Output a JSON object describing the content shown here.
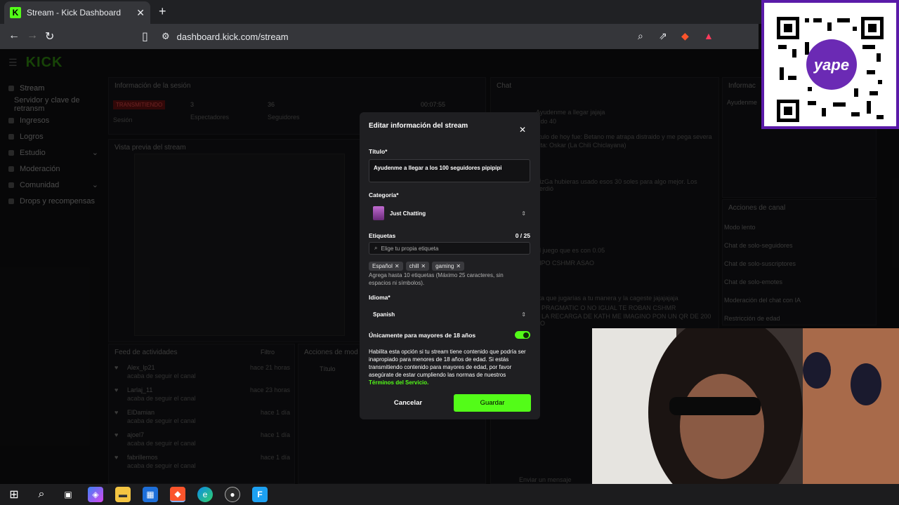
{
  "browser": {
    "tab_title": "Stream - Kick Dashboard",
    "url": "dashboard.kick.com/stream"
  },
  "sidebar": {
    "items": [
      {
        "label": "Stream"
      },
      {
        "label": "Servidor y clave de retransm"
      },
      {
        "label": "Ingresos"
      },
      {
        "label": "Logros"
      },
      {
        "label": "Estudio"
      },
      {
        "label": "Moderación"
      },
      {
        "label": "Comunidad"
      },
      {
        "label": "Drops y recompensas"
      }
    ]
  },
  "session": {
    "header": "Información de la sesión",
    "status": "TRANSMITIENDO",
    "status_sub": "Sesión",
    "viewers": "3",
    "viewers_label": "Espectadores",
    "followers": "36",
    "followers_label": "Seguidores",
    "time": "00:07:55"
  },
  "preview": {
    "header": "Vista previa del stream"
  },
  "feed": {
    "header": "Feed de actividades",
    "filter": "Filtro",
    "items": [
      {
        "name": "Alex_lp21",
        "action": "acaba de seguir el canal",
        "time": "hace 21 horas"
      },
      {
        "name": "Larlaj_11",
        "action": "acaba de seguir el canal",
        "time": "hace 23 horas"
      },
      {
        "name": "ElDamian",
        "action": "acaba de seguir el canal",
        "time": "hace 1 día"
      },
      {
        "name": "ajoel7",
        "action": "acaba de seguir el canal",
        "time": "hace 1 día"
      },
      {
        "name": "fabrillemos",
        "action": "acaba de seguir el canal",
        "time": "hace 1 día"
      }
    ]
  },
  "mod_actions": {
    "header": "Acciones de mod",
    "title_label": "Título"
  },
  "chat": {
    "header": "Chat",
    "input_placeholder": "Enviar un mensaje",
    "lines": [
      "Ayudenme a llegar jajaja",
      "sido 40",
      "titulo de hoy fue: Betano me atrapa distraido y me pega severa",
      "ista: Oskar (La Chili Chiclayana)",
      "trizGa hubieras usado esos 30 soles para algo mejor. Los perdió",
      "al juego que es con 0.05",
      "MPO CSHMR ASAO",
      "sta que jugarías a tu manera y la cageste jajajajaja",
      "A PRAGMATIC O NO IGUAL TE ROBAN CSHMR",
      "A LA RECARGA DE KATH ME IMAGINO PON UN QR DE 200 SO"
    ]
  },
  "channel_actions": {
    "header": "Acciones de canal",
    "items": [
      {
        "label": "Modo lento"
      },
      {
        "label": "Chat de solo-seguidores"
      },
      {
        "label": "Chat de solo-suscriptores"
      },
      {
        "label": "Chat de solo-emotes"
      },
      {
        "label": "Moderación del chat con IA"
      },
      {
        "label": "Restricción de edad"
      }
    ]
  },
  "info_panel": {
    "header": "Informac",
    "line": "Ayudenme"
  },
  "modal": {
    "title": "Editar información del stream",
    "title_label": "Título*",
    "title_value": "Ayudenme a llegar a los 100 seguidores pipipipi",
    "category_label": "Categoría*",
    "category_value": "Just Chatting",
    "tags_label": "Etiquetas",
    "tags_count": "0 / 25",
    "tags_placeholder": "Elige tu propia etiqueta",
    "tags": [
      "Español",
      "chill",
      "gaming"
    ],
    "tags_help": "Agrega hasta 10 etiquetas (Máximo 25 caracteres, sin espacios ni símbolos).",
    "language_label": "Idioma*",
    "language_value": "Spanish",
    "adult_label": "Únicamente para mayores de 18 años",
    "adult_enabled": true,
    "adult_help": "Habilita esta opción si tu stream tiene contenido que podría ser inapropiado para menores de 18 años de edad. Si estás transmitiendo contenido para mayores de edad, por favor asegúrate de estar cumpliendo las normas de nuestros",
    "adult_help_link": "Términos del Servicio.",
    "cancel_label": "Cancelar",
    "save_label": "Guardar",
    "accent_color": "#53fc18"
  },
  "qr": {
    "brand": "yape"
  }
}
